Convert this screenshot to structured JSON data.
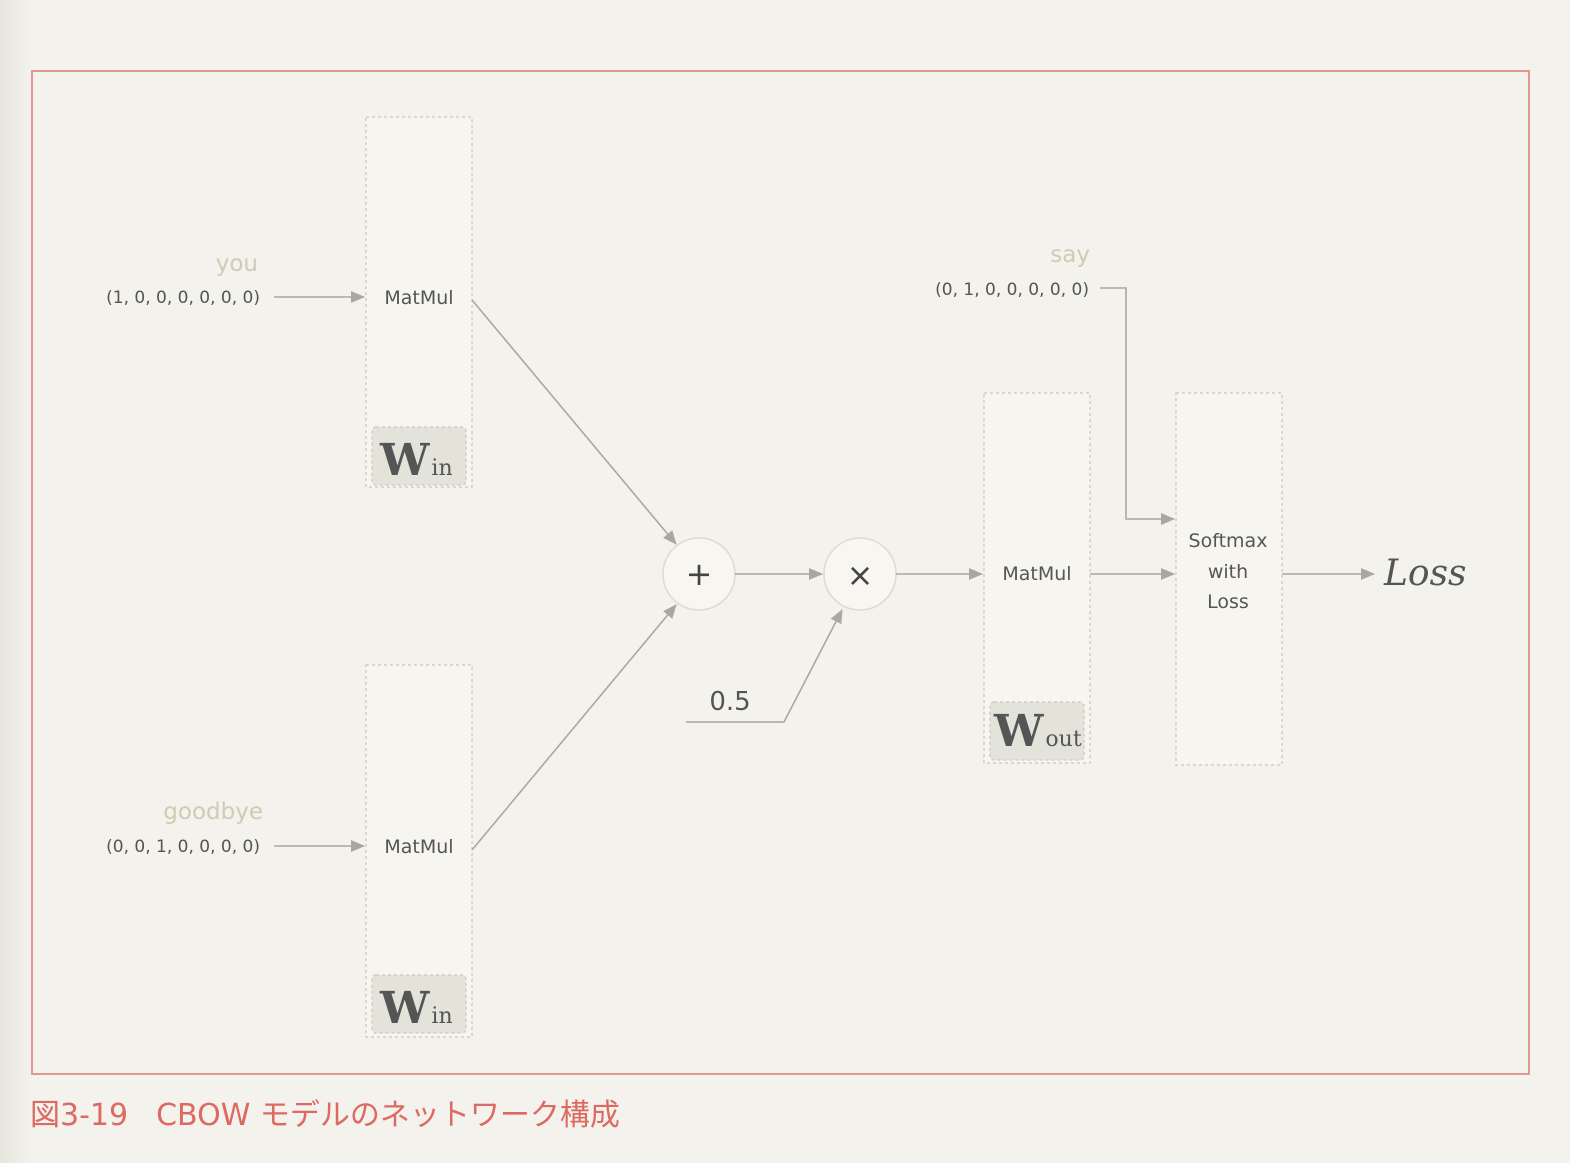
{
  "figure": {
    "caption_number": "図3-19",
    "caption_text": "CBOW モデルのネットワーク構成"
  },
  "inputs": {
    "you": {
      "word": "you",
      "vector": "(1, 0, 0, 0, 0, 0, 0)"
    },
    "goodbye": {
      "word": "goodbye",
      "vector": "(0, 0, 1, 0, 0, 0, 0)"
    },
    "say": {
      "word": "say",
      "vector": "(0, 1, 0, 0, 0, 0, 0)"
    }
  },
  "layers": {
    "matmul_in_top": {
      "label": "MatMul",
      "weight": "W",
      "weight_sub": "in"
    },
    "matmul_in_bottom": {
      "label": "MatMul",
      "weight": "W",
      "weight_sub": "in"
    },
    "matmul_out": {
      "label": "MatMul",
      "weight": "W",
      "weight_sub": "out"
    },
    "softmax": {
      "line1": "Softmax",
      "line2": "with",
      "line3": "Loss"
    }
  },
  "ops": {
    "add": "+",
    "multiply": "×",
    "scale": "0.5"
  },
  "output": {
    "label": "Loss"
  },
  "colors": {
    "frame": "#e39790",
    "caption": "#dd6a62",
    "word_label": "#cfcbb4",
    "text": "#555555",
    "line": "#b0b0a8",
    "weight_bg": "#e3e3da"
  }
}
